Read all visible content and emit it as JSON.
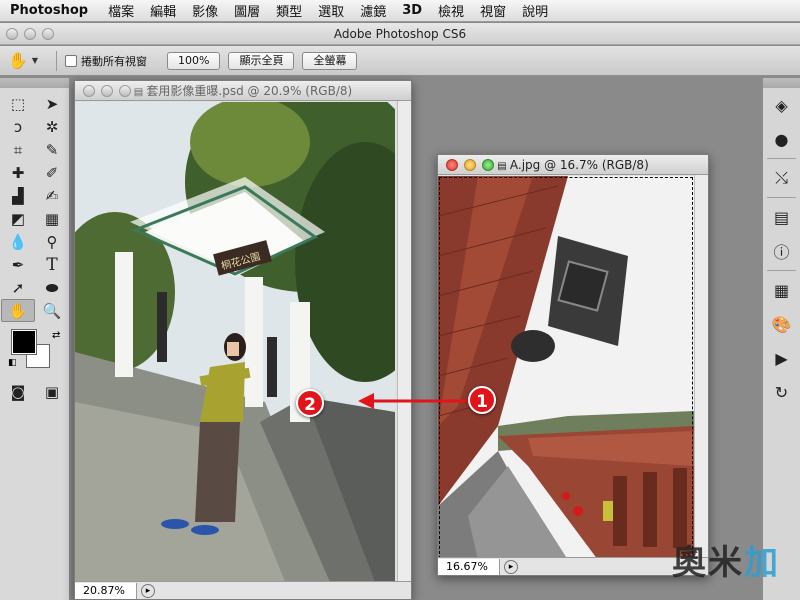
{
  "menubar": {
    "app": "Photoshop",
    "items": [
      "檔案",
      "編輯",
      "影像",
      "圖層",
      "類型",
      "選取",
      "濾鏡",
      "3D",
      "檢視",
      "視窗",
      "說明"
    ]
  },
  "app_title": "Adobe Photoshop CS6",
  "options": {
    "scroll_all_label": "捲動所有視窗",
    "zoom_100": "100%",
    "fit_screen": "顯示全頁",
    "fill_screen": "全螢幕"
  },
  "doc_left": {
    "title": "套用影像重曝.psd @ 20.9% (RGB/8)",
    "zoom": "20.87%",
    "sign_text": "桐花公園"
  },
  "doc_right": {
    "title": "A.jpg @ 16.7% (RGB/8)",
    "zoom": "16.67%"
  },
  "annotations": {
    "one": "1",
    "two": "2"
  },
  "watermark": {
    "main": "奧米",
    "accent": "加"
  },
  "colors": {
    "accent_red": "#e0141b",
    "watermark_blue": "#2a9fd6"
  }
}
